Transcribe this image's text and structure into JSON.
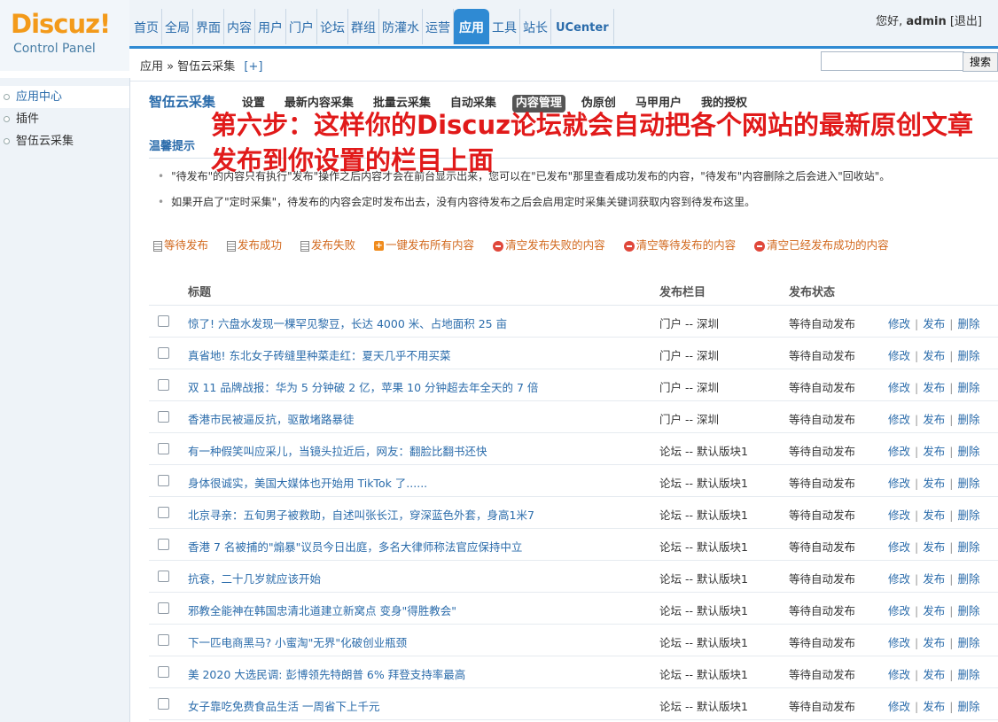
{
  "header": {
    "logo_text": "Discuz!",
    "logo_sub": "Control Panel",
    "nav": [
      "首页",
      "全局",
      "界面",
      "内容",
      "用户",
      "门户",
      "论坛",
      "群组",
      "防灌水",
      "运营",
      "应用",
      "工具",
      "站长",
      "UCenter"
    ],
    "active_nav": "应用",
    "greeting": "您好,",
    "username": "admin",
    "logout": "[退出]"
  },
  "subheader": {
    "crumb_root": "应用",
    "crumb_sep": "»",
    "crumb_current": "智伍云采集",
    "crumb_plus": "[+]",
    "search_value": "",
    "search_button": "搜索"
  },
  "sidebar": {
    "items": [
      {
        "label": "应用中心",
        "active": true
      },
      {
        "label": "插件",
        "active": false
      },
      {
        "label": "智伍云采集",
        "active": false
      }
    ]
  },
  "plugin": {
    "title": "智伍云采集",
    "tabs": [
      "设置",
      "最新内容采集",
      "批量云采集",
      "自动采集",
      "内容管理",
      "伪原创",
      "马甲用户",
      "我的授权"
    ],
    "active_tab": "内容管理"
  },
  "caption": "第六步：这样你的Discuz论坛就会自动把各个网站的最新原创文章发布到你设置的栏目上面",
  "tips": {
    "label": "温馨提示",
    "lines": [
      "\"待发布\"的内容只有执行\"发布\"操作之后内容才会在前台显示出来，您可以在\"已发布\"那里查看成功发布的内容，\"待发布\"内容删除之后会进入\"回收站\"。",
      "如果开启了\"定时采集\"，待发布的内容会定时发布出去，没有内容待发布之后会启用定时采集关键词获取内容到待发布这里。"
    ]
  },
  "actions": [
    {
      "label": "等待发布",
      "icon": "list-icon"
    },
    {
      "label": "发布成功",
      "icon": "list-icon"
    },
    {
      "label": "发布失败",
      "icon": "list-icon"
    },
    {
      "label": "一键发布所有内容",
      "icon": "add-icon"
    },
    {
      "label": "清空发布失败的内容",
      "icon": "delete-icon"
    },
    {
      "label": "清空等待发布的内容",
      "icon": "delete-icon"
    },
    {
      "label": "清空已经发布成功的内容",
      "icon": "delete-icon"
    }
  ],
  "table": {
    "columns": [
      "标题",
      "发布栏目",
      "发布状态"
    ],
    "ops": [
      "修改",
      "发布",
      "删除"
    ],
    "rows": [
      {
        "title": "惊了! 六盘水发现一棵罕见黎豆，长达 4000 米、占地面积 25 亩",
        "column": "门户 -- 深圳",
        "status": "等待自动发布"
      },
      {
        "title": "真省地! 东北女子砖缝里种菜走红：夏天几乎不用买菜",
        "column": "门户 -- 深圳",
        "status": "等待自动发布"
      },
      {
        "title": "双 11 品牌战报：华为 5 分钟破 2 亿，苹果 10 分钟超去年全天的 7 倍",
        "column": "门户 -- 深圳",
        "status": "等待自动发布"
      },
      {
        "title": "香港市民被逼反抗，驱散堵路暴徒",
        "column": "门户 -- 深圳",
        "status": "等待自动发布"
      },
      {
        "title": "有一种假笑叫应采儿，当镜头拉近后，网友：翻脸比翻书还快",
        "column": "论坛 -- 默认版块1",
        "status": "等待自动发布"
      },
      {
        "title": "身体很诚实，美国大媒体也开始用 TikTok 了......",
        "column": "论坛 -- 默认版块1",
        "status": "等待自动发布"
      },
      {
        "title": "北京寻亲：五旬男子被救助，自述叫张长江，穿深蓝色外套，身高1米7",
        "column": "论坛 -- 默认版块1",
        "status": "等待自动发布"
      },
      {
        "title": "香港 7 名被捕的\"煽暴\"议员今日出庭，多名大律师称法官应保持中立",
        "column": "论坛 -- 默认版块1",
        "status": "等待自动发布"
      },
      {
        "title": "抗衰，二十几岁就应该开始",
        "column": "论坛 -- 默认版块1",
        "status": "等待自动发布"
      },
      {
        "title": "邪教全能神在韩国忠清北道建立新窝点 变身\"得胜教会\"",
        "column": "论坛 -- 默认版块1",
        "status": "等待自动发布"
      },
      {
        "title": "下一匹电商黑马? 小蜜淘\"无界\"化破创业瓶颈",
        "column": "论坛 -- 默认版块1",
        "status": "等待自动发布"
      },
      {
        "title": "美 2020 大选民调: 彭博领先特朗普 6% 拜登支持率最高",
        "column": "论坛 -- 默认版块1",
        "status": "等待自动发布"
      },
      {
        "title": "女子靠吃免费食品生活 一周省下上千元",
        "column": "论坛 -- 默认版块1",
        "status": "等待自动发布"
      }
    ]
  }
}
